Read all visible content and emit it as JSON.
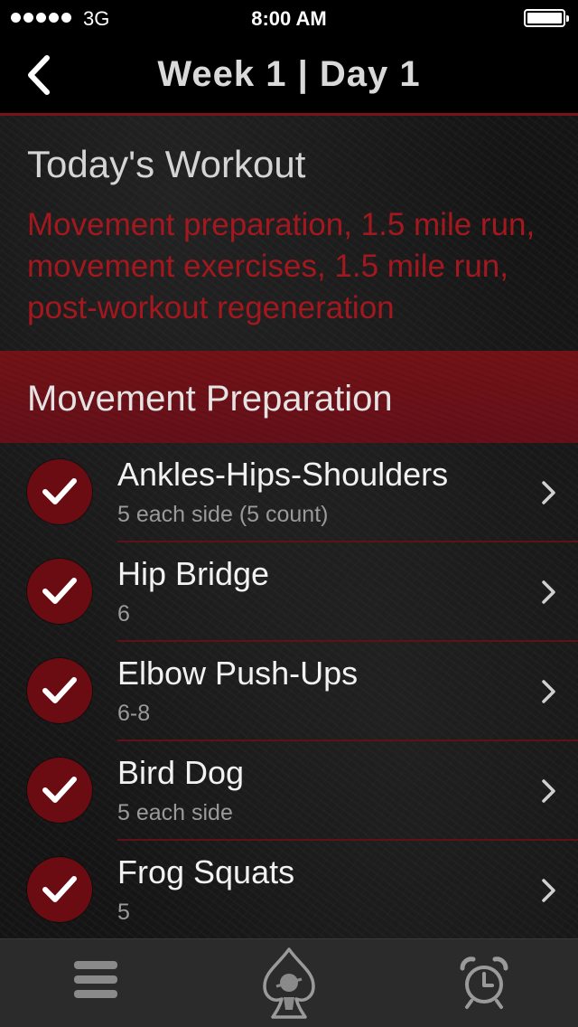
{
  "status_bar": {
    "carrier": "3G",
    "time": "8:00 AM",
    "battery_level": 1.0,
    "icons": [
      "signal-dots-icon",
      "battery-icon"
    ]
  },
  "nav": {
    "title": "Week 1 | Day 1",
    "back_icon": "chevron-left-icon"
  },
  "summary": {
    "title": "Today's Workout",
    "description": "Movement preparation, 1.5 mile run, movement exercises, 1.5 mile run, post-workout regeneration"
  },
  "section": {
    "title": "Movement Preparation"
  },
  "exercises": [
    {
      "name": "Ankles-Hips-Shoulders",
      "detail": "5 each side (5 count)",
      "completed": true
    },
    {
      "name": "Hip Bridge",
      "detail": "6",
      "completed": true
    },
    {
      "name": "Elbow Push-Ups",
      "detail": "6-8",
      "completed": true
    },
    {
      "name": "Bird Dog",
      "detail": "5 each side",
      "completed": true
    },
    {
      "name": "Frog Squats",
      "detail": "5",
      "completed": true
    }
  ],
  "tab_bar": {
    "items": [
      "menu-icon",
      "emblem-icon",
      "alarm-clock-icon"
    ]
  },
  "colors": {
    "accent_red": "#a3181f",
    "section_red": "#741317",
    "check_circle": "#6a0c12",
    "nav_background": "#000000",
    "tab_bar_background": "#2b2b2b"
  }
}
